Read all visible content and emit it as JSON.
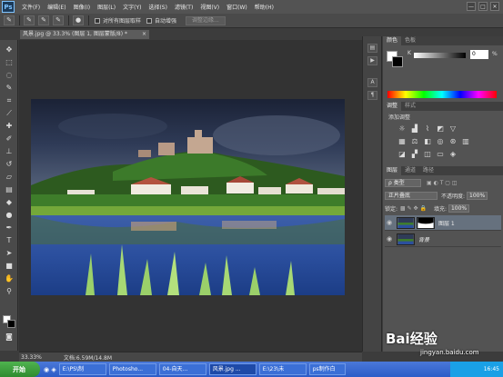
{
  "app": {
    "logo": "Ps"
  },
  "menu": [
    "文件(F)",
    "编辑(E)",
    "图像(I)",
    "图层(L)",
    "文字(Y)",
    "选择(S)",
    "滤镜(T)",
    "视图(V)",
    "窗口(W)",
    "帮助(H)"
  ],
  "window_controls": [
    "—",
    "□",
    "✕"
  ],
  "options": {
    "sample_all_label": "对所有图层取样",
    "auto_enhance_label": "自动增强",
    "refine_edge_label": "调整边缘..."
  },
  "document": {
    "tab_title": "风景.jpg @ 33.3% (图层 1, 图层蒙版/8) *",
    "tab_close": "×",
    "zoom": "33.33%",
    "doc_info": "文档:6.59M/14.8M"
  },
  "panels": {
    "color_tabs": [
      "颜色",
      "色板"
    ],
    "k_label": "K",
    "k_value": "0",
    "k_unit": "%",
    "adjust_tabs": [
      "调整",
      "样式"
    ],
    "add_adjustment_label": "添加调整",
    "layers_tabs": [
      "图层",
      "通道",
      "路径"
    ],
    "kind_filter": "ρ 类型",
    "blend_mode": "正片叠底",
    "opacity_label": "不透明度:",
    "opacity_value": "100%",
    "lock_label": "锁定:",
    "fill_label": "填充:",
    "fill_value": "100%"
  },
  "layers": [
    {
      "name": "图层 1",
      "selected": true
    },
    {
      "name": "背景",
      "selected": false
    }
  ],
  "taskbar": {
    "start_label": "开始",
    "tasks": [
      "E:\\PS\\制",
      "Photosho...",
      "04-自天...",
      "风景.jpg ...",
      "E:\\23\\未",
      "ps制作白"
    ],
    "active_task_index": 3,
    "clock": "16:45"
  },
  "watermark": {
    "brand": "Bai经验",
    "url": "jingyan.baidu.com"
  }
}
